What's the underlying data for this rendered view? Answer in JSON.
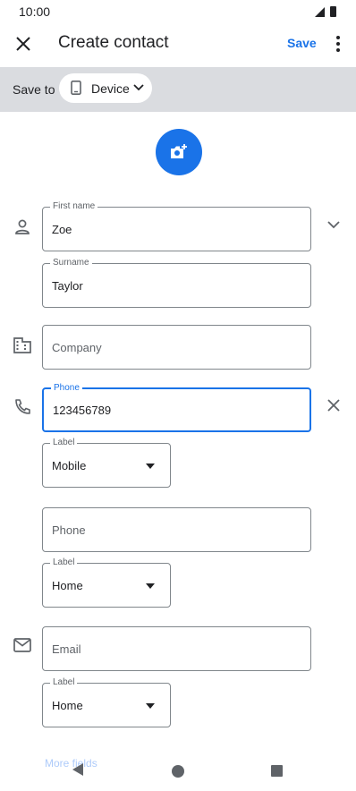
{
  "status": {
    "time": "10:00",
    "icons": [
      "signal-icon",
      "battery-icon"
    ]
  },
  "topbar": {
    "title": "Create contact",
    "save_label": "Save",
    "close_icon": "close-icon",
    "more_icon": "more-vert-icon"
  },
  "save_to": {
    "label": "Save to",
    "chip_label": "Device",
    "chip_icon": "phone-icon"
  },
  "photo": {
    "icon": "add-photo-icon",
    "color": "#1a73e8"
  },
  "name": {
    "first_label": "First name",
    "first_value": "Zoe",
    "surname_label": "Surname",
    "surname_value": "Taylor"
  },
  "company": {
    "placeholder": "Company"
  },
  "phone1": {
    "label": "Phone",
    "value": "123456789",
    "type_label": "Label",
    "type_value": "Mobile"
  },
  "phone2": {
    "placeholder": "Phone",
    "type_label": "Label",
    "type_value": "Home"
  },
  "email": {
    "placeholder": "Email",
    "type_label": "Label",
    "type_value": "Home"
  },
  "more_fields": "More fields",
  "colors": {
    "accent": "#1a73e8",
    "band": "#dadce0",
    "outline": "#80868b"
  }
}
